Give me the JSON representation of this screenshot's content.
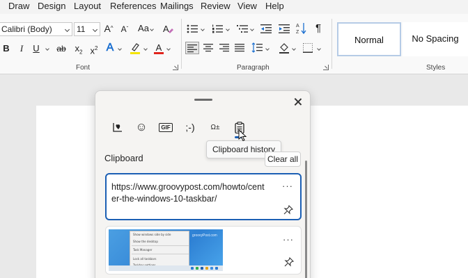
{
  "menu": [
    "Draw",
    "Design",
    "Layout",
    "References",
    "Mailings",
    "Review",
    "View",
    "Help"
  ],
  "font": {
    "family": "Calibri (Body)",
    "size": "11",
    "grow": "A",
    "shrink": "A",
    "case": "Aa",
    "bold": "B",
    "italic": "I",
    "underline": "U",
    "strike": "ab",
    "subscript": "x",
    "subscript_mark": "2",
    "superscript": "x",
    "superscript_mark": "2",
    "text_effects": "A",
    "font_color": "A",
    "group_label": "Font",
    "highlight_color": "#f4e400",
    "font_color_bar": "#e0241d"
  },
  "paragraph": {
    "group_label": "Paragraph",
    "pilcrow": "¶"
  },
  "styles": {
    "group_label": "Styles",
    "items": [
      "Normal",
      "No Spacing"
    ]
  },
  "clipboard_panel": {
    "tabs": [
      {
        "name": "Kaomoji favorites",
        "icon": "heart-note-icon"
      },
      {
        "name": "Emoji",
        "icon": "smiley-icon",
        "glyph": "☺"
      },
      {
        "name": "GIF",
        "icon": "gif-icon",
        "text": "GIF"
      },
      {
        "name": "Kaomoji",
        "icon": "kaomoji-icon",
        "text": ";-)"
      },
      {
        "name": "Symbols",
        "icon": "symbols-icon",
        "text": "Ω±"
      },
      {
        "name": "Clipboard history",
        "icon": "clipboard-icon"
      }
    ],
    "tooltip": "Clipboard history",
    "title": "Clipboard",
    "clear_all": "Clear all",
    "items": [
      {
        "text": "https://www.groovypost.com/howto/center-the-windows-10-taskbar/",
        "more": "···"
      },
      {
        "type": "image",
        "more": "···",
        "thumbnail_menu": [
          "Show windows side by side",
          "Show the desktop",
          "Task Manager",
          "Lock all taskbars",
          "Taskbar settings"
        ],
        "thumbnail_watermark": "groovyPost.com"
      }
    ],
    "accent_color": "#1b5fb4"
  }
}
